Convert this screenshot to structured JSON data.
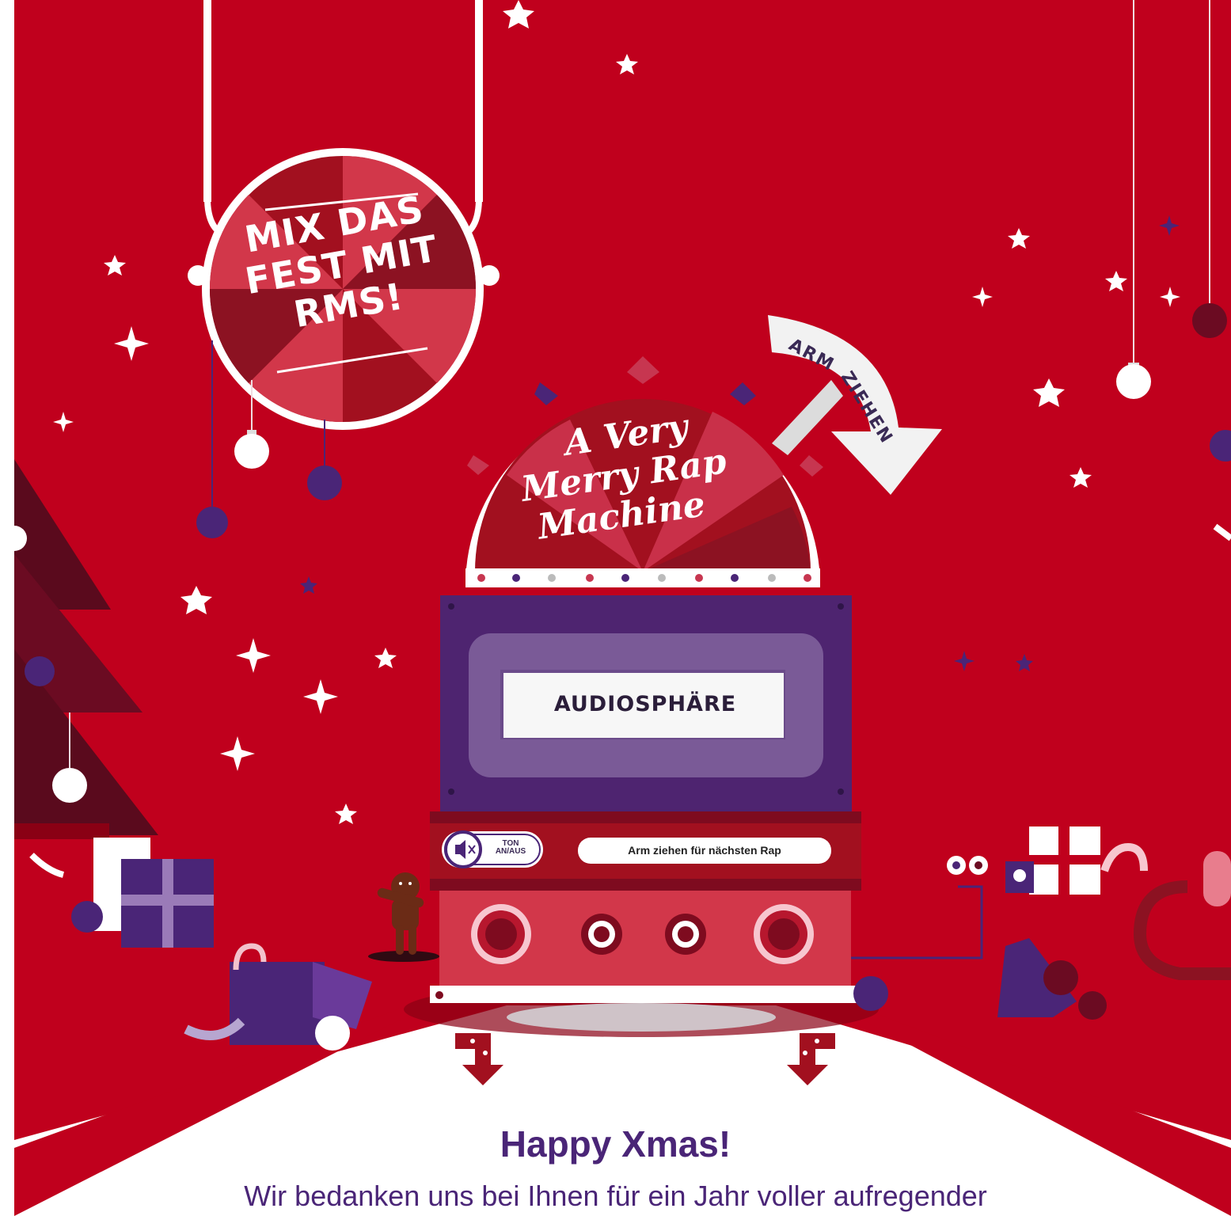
{
  "badge": {
    "line1": "MIX DAS",
    "line2": "FEST MIT",
    "line3": "RMS!"
  },
  "machine": {
    "dome_title_line1": "A Very",
    "dome_title_line2": "Merry Rap",
    "dome_title_line3": "Machine",
    "arm_label": "ARM ZIEHEN",
    "display_text": "AUDIOSPHÄRE",
    "sound_toggle_label": "TON AN/AUS",
    "sound_toggle_line1": "TON",
    "sound_toggle_line2": "AN/AUS",
    "hint": "Arm ziehen für nächsten Rap"
  },
  "content": {
    "heading": "Happy Xmas!",
    "text": "Wir bedanken uns bei Ihnen für ein Jahr voller aufregender"
  },
  "colors": {
    "background_red": "#c0001d",
    "purple": "#4a2577",
    "machine_purple": "#4e2470",
    "display_purple": "#7a5a97",
    "white": "#ffffff"
  }
}
